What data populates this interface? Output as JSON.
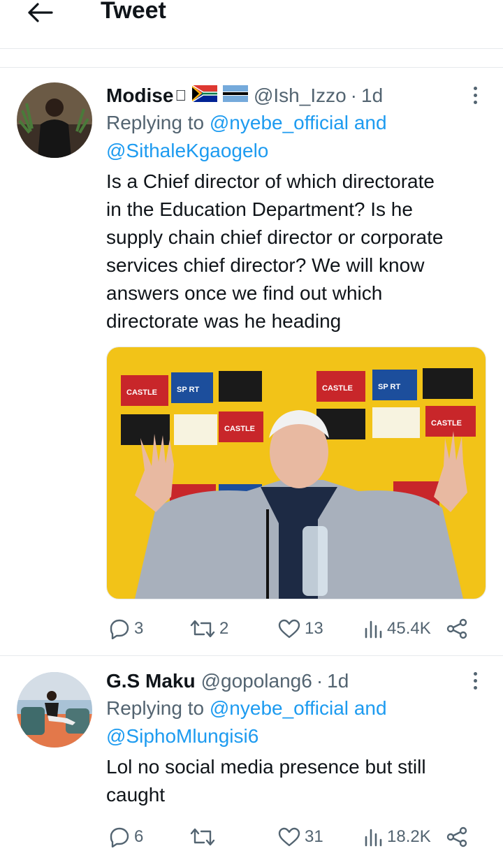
{
  "header": {
    "title": "Tweet",
    "back_icon": "arrow-left-icon"
  },
  "tweets": [
    {
      "display_name": "Modise",
      "name_emojis": [
        "apple-icon",
        "flag-south-africa-icon",
        "flag-botswana-icon"
      ],
      "handle": "@Ish_Izzo",
      "separator": "·",
      "time": "1d",
      "reply_prefix": "Replying to",
      "reply_mention_1": "@nyebe_official",
      "reply_and": "and",
      "reply_mention_2": "@SithaleKgaogelo",
      "text_lines": [
        "Is a Chief director of which directorate",
        "in the Education Department? Is he",
        "supply chain chief director or corporate",
        "services chief director? We will know",
        "answers once we find out which",
        "directorate was he heading"
      ],
      "media": {
        "backdrop_texts": [
          "CASTLE",
          "SP RT",
          "CASTLE",
          "SP RT",
          "CASTLE",
          "CASTLE"
        ]
      },
      "stats": {
        "replies": "3",
        "retweets": "2",
        "likes": "13",
        "views": "45.4K"
      }
    },
    {
      "display_name": "G.S Maku",
      "handle": "@gopolang6",
      "separator": "·",
      "time": "1d",
      "reply_prefix": "Replying to",
      "reply_mention_1": "@nyebe_official",
      "reply_and": "and",
      "reply_mention_2": "@SiphoMlungisi6",
      "text_lines": [
        "Lol no social media presence but still",
        "caught"
      ],
      "stats": {
        "replies": "6",
        "retweets": "",
        "likes": "31",
        "views": "18.2K"
      }
    }
  ],
  "colors": {
    "accent": "#1d9bf0",
    "muted": "#536471",
    "text": "#0f1419",
    "divider": "#e6e9ec"
  }
}
